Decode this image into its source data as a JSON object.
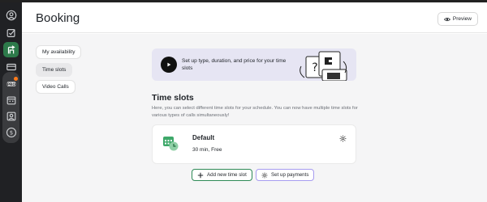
{
  "header": {
    "title": "Booking",
    "preview_label": "Preview"
  },
  "rail": {
    "items": [
      "person-icon",
      "checklist-icon",
      "booking-icon",
      "card-icon",
      "promo-icon",
      "calendar-icon",
      "contact-icon",
      "dollar-icon"
    ],
    "active": "booking-icon",
    "accent_color": "#2d7a4a"
  },
  "sidebar": {
    "tabs": [
      {
        "label": "My availability",
        "selected": false
      },
      {
        "label": "Time slots",
        "selected": true
      },
      {
        "label": "Video Calls",
        "selected": false
      }
    ]
  },
  "banner": {
    "text": "Set up type, duration, and price for your time slots"
  },
  "section": {
    "title": "Time slots",
    "description": "Here, you can select different time slots for your schedule. You can now have multiple time slots for various types of calls simultaneously!"
  },
  "slot_card": {
    "title": "Default",
    "subtitle": "30 min, Free",
    "icon_color": "#3ea86a"
  },
  "actions": {
    "add_label": "Add new time slot",
    "payments_label": "Set up payments"
  }
}
